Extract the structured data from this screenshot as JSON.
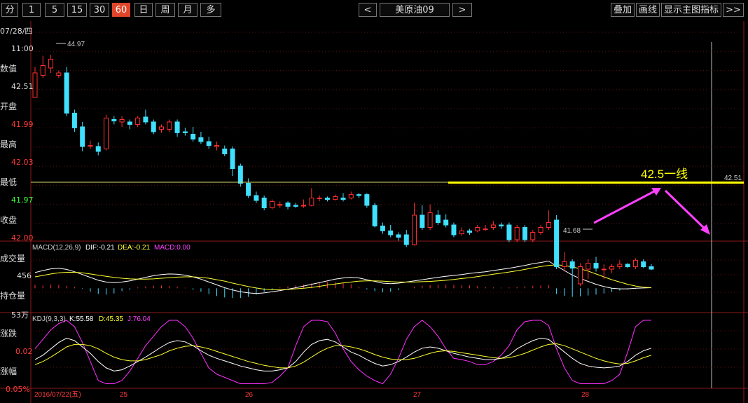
{
  "toolbar": {
    "periods": [
      "分",
      "1",
      "5",
      "15",
      "30",
      "60",
      "日",
      "周",
      "月",
      "多"
    ],
    "active_period": "60",
    "prev_symbol": "<",
    "symbol": "美原油09",
    "next_symbol": ">",
    "overlay_label": "叠加",
    "draw_label": "画线",
    "show_indicator_label": "显示主图指标",
    "more_label": ">>"
  },
  "left_panel": {
    "date": "07/28/四",
    "time": "11:00",
    "value_label": "数值",
    "value": "42.51",
    "open_label": "开盘",
    "open": "41.99",
    "high_label": "最高",
    "high": "42.03",
    "low_label": "最低",
    "low": "41.97",
    "close_label": "收盘",
    "close": "42.00",
    "volume_label": "成交量",
    "volume": "456",
    "oi_label": "持仓量",
    "oi": "53万",
    "change_label": "涨跌",
    "change": "0.02",
    "pct_label": "涨幅",
    "pct": "0.05%"
  },
  "colors": {
    "up": "#ff3030",
    "down": "#40e0ff",
    "dif": "#ffffff",
    "dea": "#ffff30",
    "kdj_k": "#ffffff",
    "kdj_d": "#ffff30",
    "kdj_j": "#ff30ff",
    "annotation_line": "#ffff00",
    "arrow": "#ff40ff"
  },
  "chart_data": {
    "type": "candlestick",
    "time_labels": [
      "2016/07/22(五)",
      "25",
      "26",
      "27",
      "28"
    ],
    "max_label": "44.97",
    "min_label": "41.68",
    "current_price_label": "42.51",
    "annotation_text": "42.5一线",
    "annotation_price": 42.51,
    "ylim": [
      41.2,
      45.6
    ],
    "candles": [
      [
        44.1,
        44.6,
        44.25,
        44.72
      ],
      [
        44.55,
        44.75,
        44.5,
        44.95
      ],
      [
        44.7,
        44.88,
        44.6,
        44.97
      ],
      [
        44.55,
        44.6,
        44.5,
        44.65
      ],
      [
        44.6,
        43.78,
        43.72,
        44.72
      ],
      [
        43.78,
        43.48,
        43.4,
        43.85
      ],
      [
        43.5,
        43.1,
        43.0,
        43.6
      ],
      [
        43.12,
        43.12,
        43.05,
        43.22
      ],
      [
        43.1,
        43.0,
        42.92,
        43.18
      ],
      [
        43.05,
        43.68,
        43.02,
        43.75
      ],
      [
        43.65,
        43.62,
        43.55,
        43.72
      ],
      [
        43.6,
        43.65,
        43.5,
        43.72
      ],
      [
        43.6,
        43.55,
        43.45,
        43.65
      ],
      [
        43.55,
        43.68,
        43.5,
        43.72
      ],
      [
        43.7,
        43.6,
        43.55,
        43.85
      ],
      [
        43.6,
        43.4,
        43.35,
        43.65
      ],
      [
        43.45,
        43.5,
        43.38,
        43.55
      ],
      [
        43.45,
        43.6,
        43.4,
        43.65
      ],
      [
        43.6,
        43.38,
        43.3,
        43.65
      ],
      [
        43.4,
        43.38,
        43.32,
        43.48
      ],
      [
        43.35,
        43.25,
        43.2,
        43.5
      ],
      [
        43.28,
        43.2,
        43.15,
        43.4
      ],
      [
        43.2,
        43.12,
        43.05,
        43.3
      ],
      [
        43.1,
        43.12,
        43.02,
        43.2
      ],
      [
        43.05,
        42.95,
        42.9,
        43.12
      ],
      [
        43.05,
        42.65,
        42.5,
        43.1
      ],
      [
        42.7,
        42.35,
        42.28,
        42.75
      ],
      [
        42.35,
        42.1,
        42.05,
        42.45
      ],
      [
        42.1,
        42.0,
        41.95,
        42.18
      ],
      [
        42.05,
        41.85,
        41.8,
        42.1
      ],
      [
        41.85,
        41.98,
        41.82,
        42.02
      ],
      [
        41.9,
        41.92,
        41.85,
        41.98
      ],
      [
        41.95,
        41.88,
        41.82,
        41.98
      ],
      [
        41.9,
        41.88,
        41.85,
        41.95
      ],
      [
        41.9,
        41.9,
        41.85,
        42.02
      ],
      [
        41.9,
        42.05,
        41.88,
        42.25
      ],
      [
        42.05,
        42.05,
        41.98,
        42.1
      ],
      [
        42.05,
        42.02,
        41.98,
        42.08
      ],
      [
        42.02,
        42.08,
        42.0,
        42.12
      ],
      [
        42.05,
        42.02,
        41.98,
        42.15
      ],
      [
        42.05,
        42.12,
        42.02,
        42.18
      ],
      [
        42.12,
        42.1,
        42.05,
        42.15
      ],
      [
        42.12,
        41.9,
        41.85,
        42.15
      ],
      [
        41.9,
        41.48,
        41.45,
        41.95
      ],
      [
        41.48,
        41.38,
        41.32,
        41.55
      ],
      [
        41.38,
        41.3,
        41.25,
        41.5
      ],
      [
        41.3,
        41.25,
        41.18,
        41.35
      ],
      [
        41.3,
        41.1,
        41.05,
        41.4
      ],
      [
        41.1,
        41.7,
        41.08,
        41.95
      ],
      [
        41.7,
        41.45,
        41.4,
        41.9
      ],
      [
        41.45,
        41.75,
        41.4,
        41.92
      ],
      [
        41.7,
        41.55,
        41.5,
        41.8
      ],
      [
        41.6,
        41.5,
        41.45,
        41.72
      ],
      [
        41.5,
        41.3,
        41.25,
        41.55
      ],
      [
        41.32,
        41.38,
        41.28,
        41.45
      ],
      [
        41.38,
        41.35,
        41.3,
        41.42
      ],
      [
        41.38,
        41.45,
        41.35,
        41.5
      ],
      [
        41.42,
        41.42,
        41.38,
        41.5
      ],
      [
        41.45,
        41.5,
        41.4,
        41.58
      ],
      [
        41.5,
        41.48,
        41.42,
        41.55
      ],
      [
        41.5,
        41.2,
        41.15,
        41.55
      ],
      [
        41.2,
        41.45,
        41.15,
        41.5
      ],
      [
        41.45,
        41.2,
        41.15,
        41.5
      ],
      [
        41.2,
        41.35,
        41.15,
        41.4
      ],
      [
        41.35,
        41.45,
        41.3,
        41.5
      ],
      [
        41.45,
        41.55,
        41.4,
        41.8
      ],
      [
        41.6,
        40.65,
        40.6,
        41.7
      ],
      [
        40.65,
        40.75,
        40.55,
        40.95
      ],
      [
        40.75,
        40.62,
        40.2,
        40.8
      ],
      [
        40.3,
        40.65,
        40.25,
        40.72
      ],
      [
        40.6,
        40.72,
        40.4,
        40.8
      ],
      [
        40.72,
        40.62,
        40.55,
        40.85
      ],
      [
        40.6,
        40.6,
        40.4,
        40.7
      ],
      [
        40.6,
        40.65,
        40.52,
        40.7
      ],
      [
        40.65,
        40.7,
        40.6,
        40.78
      ],
      [
        40.7,
        40.65,
        40.62,
        40.72
      ],
      [
        40.65,
        40.78,
        40.6,
        40.82
      ],
      [
        40.75,
        40.65,
        40.62,
        40.8
      ],
      [
        40.65,
        40.6,
        40.58,
        40.7
      ]
    ],
    "macd": {
      "label": "MACD(12,26,9)",
      "dif_label": "DIF:-0.21",
      "dea_label": "DEA:-0.21",
      "macd_label": "MACD:0.00",
      "hist": [
        0.12,
        0.1,
        0.13,
        0.12,
        0.09,
        0.05,
        -0.02,
        -0.12,
        -0.2,
        -0.22,
        -0.18,
        -0.1,
        -0.05,
        0.03,
        0.07,
        0.09,
        0.1,
        0.08,
        0.06,
        0.02,
        -0.05,
        -0.12,
        -0.2,
        -0.27,
        -0.32,
        -0.34,
        -0.34,
        -0.3,
        -0.22,
        -0.12,
        -0.04,
        0.03,
        0.07,
        0.1,
        0.13,
        0.17,
        0.2,
        0.22,
        0.22,
        0.19,
        0.14,
        0.06,
        -0.04,
        -0.1,
        -0.14,
        -0.12,
        -0.06,
        0.0,
        0.05,
        0.09,
        0.11,
        0.12,
        0.13,
        0.12,
        0.11,
        0.1,
        0.08,
        0.05,
        0.03,
        0.02,
        0.03,
        0.05,
        0.07,
        0.09,
        0.1,
        0.11,
        -0.2,
        -0.26,
        -0.3,
        -0.28,
        -0.25,
        -0.22,
        -0.18,
        -0.13,
        -0.08,
        -0.04,
        -0.02,
        0.0,
        0.01
      ],
      "dif": [
        0.55,
        0.62,
        0.68,
        0.7,
        0.66,
        0.58,
        0.48,
        0.38,
        0.28,
        0.22,
        0.2,
        0.22,
        0.26,
        0.32,
        0.38,
        0.44,
        0.48,
        0.5,
        0.49,
        0.46,
        0.4,
        0.32,
        0.22,
        0.12,
        0.02,
        -0.06,
        -0.12,
        -0.16,
        -0.18,
        -0.16,
        -0.12,
        -0.08,
        -0.03,
        0.02,
        0.08,
        0.14,
        0.2,
        0.26,
        0.32,
        0.36,
        0.38,
        0.36,
        0.3,
        0.24,
        0.18,
        0.16,
        0.18,
        0.22,
        0.26,
        0.3,
        0.34,
        0.38,
        0.42,
        0.45,
        0.48,
        0.52,
        0.55,
        0.58,
        0.62,
        0.66,
        0.7,
        0.75,
        0.8,
        0.86,
        0.9,
        0.95,
        0.78,
        0.62,
        0.46,
        0.34,
        0.24,
        0.14,
        0.06,
        0.0,
        -0.02,
        -0.02,
        0.0,
        0.01,
        0.02
      ],
      "dea": [
        0.4,
        0.45,
        0.5,
        0.54,
        0.56,
        0.56,
        0.54,
        0.5,
        0.46,
        0.42,
        0.38,
        0.35,
        0.33,
        0.32,
        0.32,
        0.33,
        0.35,
        0.37,
        0.39,
        0.4,
        0.4,
        0.38,
        0.35,
        0.3,
        0.25,
        0.18,
        0.12,
        0.06,
        0.01,
        -0.03,
        -0.05,
        -0.05,
        -0.04,
        -0.02,
        0.0,
        0.03,
        0.07,
        0.11,
        0.15,
        0.19,
        0.22,
        0.25,
        0.26,
        0.26,
        0.25,
        0.23,
        0.22,
        0.22,
        0.22,
        0.23,
        0.24,
        0.26,
        0.28,
        0.31,
        0.34,
        0.37,
        0.41,
        0.45,
        0.49,
        0.53,
        0.57,
        0.61,
        0.66,
        0.71,
        0.76,
        0.8,
        0.82,
        0.8,
        0.75,
        0.68,
        0.6,
        0.5,
        0.4,
        0.3,
        0.22,
        0.14,
        0.08,
        0.04,
        0.02
      ],
      "ylim": [
        -0.8,
        1.6
      ]
    },
    "kdj": {
      "label": "KDJ(9,3,3)",
      "k_label": "K:55.58",
      "d_label": "D:45.35",
      "j_label": "J:76.04",
      "k": [
        38,
        45,
        55,
        65,
        72,
        68,
        58,
        48,
        35,
        25,
        20,
        22,
        28,
        35,
        42,
        50,
        58,
        65,
        68,
        66,
        60,
        52,
        45,
        40,
        36,
        32,
        28,
        25,
        22,
        20,
        20,
        22,
        25,
        35,
        50,
        62,
        68,
        70,
        66,
        58,
        50,
        45,
        38,
        32,
        28,
        30,
        35,
        42,
        50,
        56,
        58,
        56,
        52,
        48,
        45,
        42,
        40,
        38,
        38,
        40,
        45,
        55,
        62,
        68,
        72,
        70,
        60,
        50,
        40,
        32,
        28,
        26,
        25,
        26,
        28,
        35,
        45,
        52,
        56
      ],
      "d": [
        30,
        35,
        42,
        50,
        58,
        62,
        62,
        60,
        55,
        48,
        42,
        38,
        36,
        36,
        38,
        42,
        46,
        52,
        56,
        59,
        60,
        58,
        55,
        51,
        47,
        43,
        39,
        35,
        32,
        29,
        27,
        25,
        25,
        28,
        34,
        42,
        50,
        56,
        60,
        60,
        58,
        55,
        51,
        46,
        42,
        39,
        38,
        38,
        40,
        44,
        48,
        51,
        52,
        51,
        49,
        47,
        45,
        43,
        41,
        40,
        41,
        44,
        48,
        53,
        58,
        62,
        63,
        60,
        55,
        50,
        45,
        40,
        36,
        33,
        31,
        32,
        36,
        41,
        45
      ],
      "j": [
        55,
        70,
        85,
        95,
        100,
        90,
        65,
        35,
        5,
        0,
        0,
        5,
        20,
        40,
        60,
        75,
        90,
        100,
        100,
        90,
        72,
        48,
        25,
        15,
        10,
        5,
        0,
        0,
        0,
        0,
        2,
        12,
        25,
        60,
        90,
        100,
        100,
        98,
        80,
        55,
        35,
        22,
        12,
        5,
        0,
        15,
        40,
        70,
        90,
        100,
        90,
        75,
        55,
        40,
        38,
        35,
        30,
        30,
        35,
        45,
        60,
        85,
        98,
        100,
        100,
        92,
        55,
        25,
        5,
        0,
        0,
        0,
        0,
        5,
        15,
        50,
        90,
        100,
        100
      ],
      "ylim": [
        -5,
        110
      ]
    }
  }
}
